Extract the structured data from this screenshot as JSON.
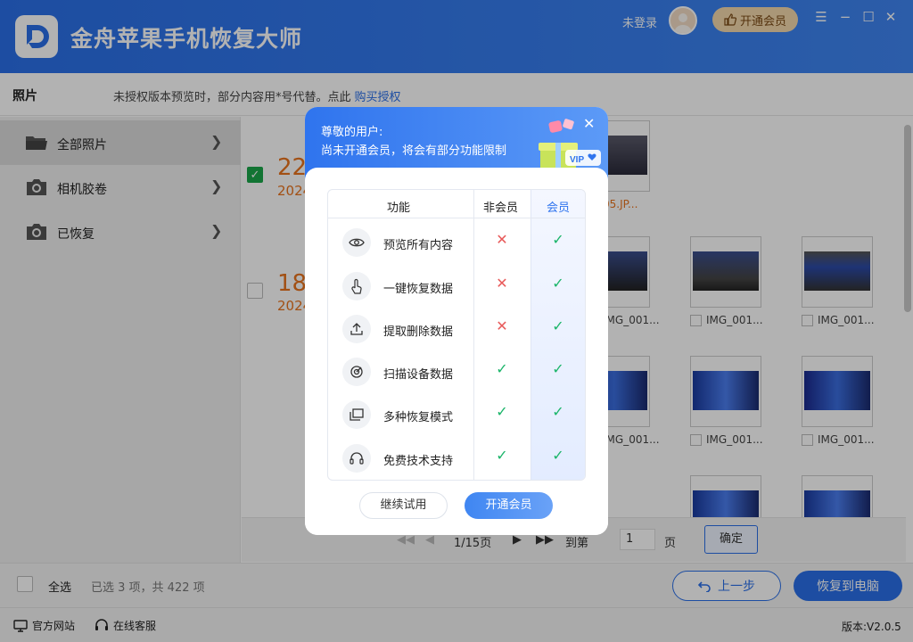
{
  "app": {
    "title": "金舟苹果手机恢复大师"
  },
  "header": {
    "login": "未登录",
    "vip_button": "开通会员"
  },
  "subbar": {
    "title": "照片",
    "notice": "未授权版本预览时，部分内容用*号代替。点此",
    "notice_link": "购买授权"
  },
  "sidebar": {
    "items": [
      {
        "label": "全部照片",
        "icon": "folder-icon"
      },
      {
        "label": "相机胶卷",
        "icon": "camera-icon"
      },
      {
        "label": "已恢复",
        "icon": "camera-icon"
      }
    ]
  },
  "main": {
    "groups": [
      {
        "day": "22",
        "year": "2024"
      },
      {
        "day": "18",
        "year": "2024"
      }
    ],
    "thumb_labels": [
      "05.JP...",
      "IMG_001...",
      "IMG_001...",
      "IMG_001...",
      "IMG_001...",
      "IMG_001...",
      "IMG_001..."
    ]
  },
  "pager": {
    "page": "1/15页",
    "goto": "到第",
    "input": "1",
    "unit": "页",
    "ok": "确定"
  },
  "bottom": {
    "select_all": "全选",
    "selected": "已选 3 项，共 422 项",
    "prev": "上一步",
    "recover": "恢复到电脑"
  },
  "footer": {
    "website": "官方网站",
    "support": "在线客服",
    "version": "版本:V2.0.5"
  },
  "modal": {
    "greeting": "尊敬的用户:",
    "message": "尚未开通会员，将会有部分功能限制",
    "vip_tag": "VIP",
    "headers": {
      "feature": "功能",
      "nonmember": "非会员",
      "member": "会员"
    },
    "rows": [
      {
        "name": "预览所有内容",
        "non": false,
        "mem": true
      },
      {
        "name": "一键恢复数据",
        "non": false,
        "mem": true
      },
      {
        "name": "提取删除数据",
        "non": false,
        "mem": true
      },
      {
        "name": "扫描设备数据",
        "non": true,
        "mem": true
      },
      {
        "name": "多种恢复模式",
        "non": true,
        "mem": true
      },
      {
        "name": "免费技术支持",
        "non": true,
        "mem": true
      }
    ],
    "trial_button": "继续试用",
    "vip_button": "开通会员"
  },
  "colors": {
    "accent": "#2a6fe8",
    "date": "#e8731e",
    "yes": "#1bb56a",
    "no": "#e85a5a"
  }
}
